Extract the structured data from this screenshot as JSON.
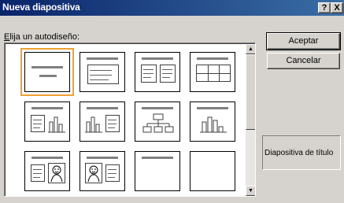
{
  "window": {
    "title": "Nueva diapositiva",
    "help_label": "?",
    "close_label": "X"
  },
  "prompt": {
    "mnemonic": "E",
    "rest": "lija un autodiseño:"
  },
  "buttons": {
    "ok": "Aceptar",
    "cancel": "Cancelar"
  },
  "description": "Diapositiva de título",
  "scroll": {
    "up_glyph": "▲",
    "down_glyph": "▼"
  },
  "layouts": [
    {
      "name": "title-slide",
      "selected": true
    },
    {
      "name": "bulleted-list"
    },
    {
      "name": "two-column-text"
    },
    {
      "name": "table"
    },
    {
      "name": "text-and-chart"
    },
    {
      "name": "chart-and-text"
    },
    {
      "name": "organization-chart"
    },
    {
      "name": "chart"
    },
    {
      "name": "text-and-clip-art"
    },
    {
      "name": "clip-art-and-text"
    },
    {
      "name": "title-only"
    },
    {
      "name": "blank"
    }
  ]
}
